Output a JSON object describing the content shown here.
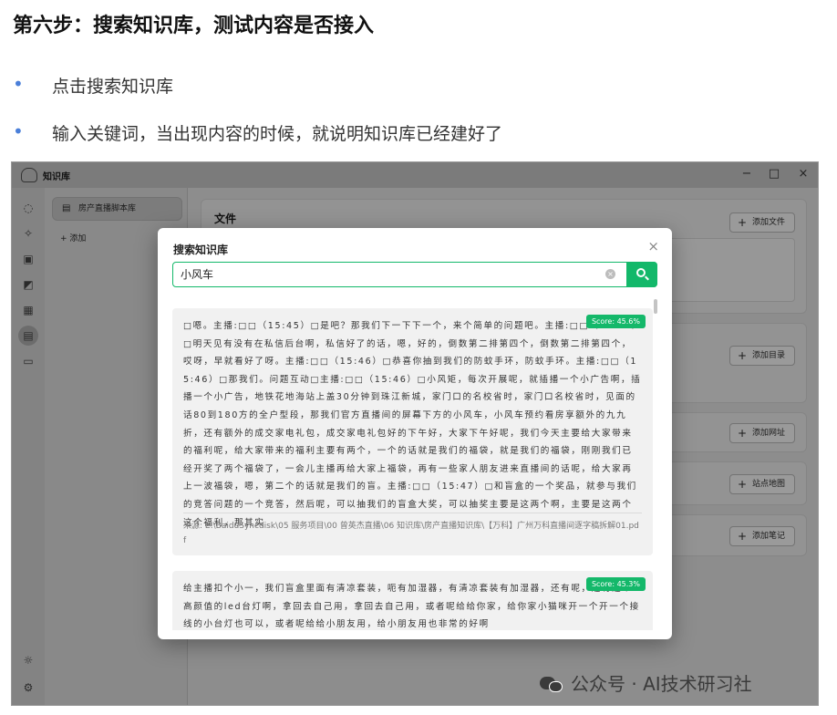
{
  "article": {
    "title": "第六步：搜索知识库，测试内容是否接入",
    "bullet_symbol": "•",
    "bullets": [
      "点击搜索知识库",
      "输入关键词，当出现内容的时候，就说明知识库已经建好了"
    ]
  },
  "app": {
    "title": "知识库",
    "window_controls": {
      "minimize": "−",
      "maximize": "□",
      "close": "×"
    },
    "rail_icons": [
      "chat-icon",
      "sparkle-icon",
      "image-icon",
      "image-edit-icon",
      "grid-icon",
      "knowledge-base-icon",
      "folder-icon",
      "sun-icon",
      "settings-icon"
    ],
    "sidebar": {
      "kb_item": "房产直播脚本库",
      "add_label": "+ 添加"
    },
    "main": {
      "file_section_title": "文件",
      "buttons": {
        "add_file": "添加文件",
        "add_directory": "添加目录",
        "add_url": "添加网址",
        "sitemap": "站点地图",
        "add_note": "添加笔记"
      }
    }
  },
  "search_modal": {
    "title": "搜索知识库",
    "query": "小风车",
    "close_label": "×",
    "results": [
      {
        "score": "Score: 45.6%",
        "text": "□嗯。主播:□□（15:45）□是吧？那我们下一下下一个，来个简单的问题吧。主播:□□（15:45）□明天见有没有在私信后台啊，私信好了的话，嗯，好的，倒数第二排第四个，倒数第二排第四个，哎呀，早就看好了呀。主播:□□（15:46）□恭喜你抽到我们的防蚊手环，防蚊手环。主播:□□（15:46）□那我们。问题互动□主播:□□（15:46）□小风矩，每次开展呢，就插播一个小广告啊，插播一个小广告，地铁花地海站上盖30分钟到珠江新城，家门口的名校省时，家门口名校省时，见面的话80到180方的全户型段，那我们官方直播间的屏幕下方的小风车，小风车预约看房享额外的九九折，还有额外的成交家电礼包，成交家电礼包好的下午好，大家下午好呢，我们今天主要给大家带来的福利呢，给大家带来的福利主要有两个，一个的话就是我们的福袋，就是我们的福袋，刚刚我们已经开奖了两个福袋了，一会儿主播再给大家上福袋，再有一些家人朋友进来直播间的话呢，给大家再上一波福袋，嗯，第二个的话就是我们的盲。主播:□□（15:47）□和盲盒的一个奖品，就参与我们的竞答问题的一个竞答，然后呢，可以抽我们的盲盒大奖，可以抽奖主要是这两个啊，主要是这两个这个福利，那其实",
        "source": "来源: E:\\BaiduSyncdisk\\05 服务项目\\00 曾英杰直播\\06 知识库\\房产直播知识库\\【万科】广州万科直播间逐字稿拆解01.pdf"
      },
      {
        "score": "Score: 45.3%",
        "text": "给主播扣个小一，我们盲盒里面有清凉套装，呃有加湿器，有清凉套装有加湿器，还有呢，还有这个高颜值的led台灯啊，拿回去自己用，拿回去自己用，或者呢给给你家，给你家小猫咪开一个开一个接线的小台灯也可以，或者呢给给小朋友用，给小朋友用也非常的好啊"
      }
    ]
  },
  "watermark": {
    "text": "公众号 · AI技术研习社"
  }
}
